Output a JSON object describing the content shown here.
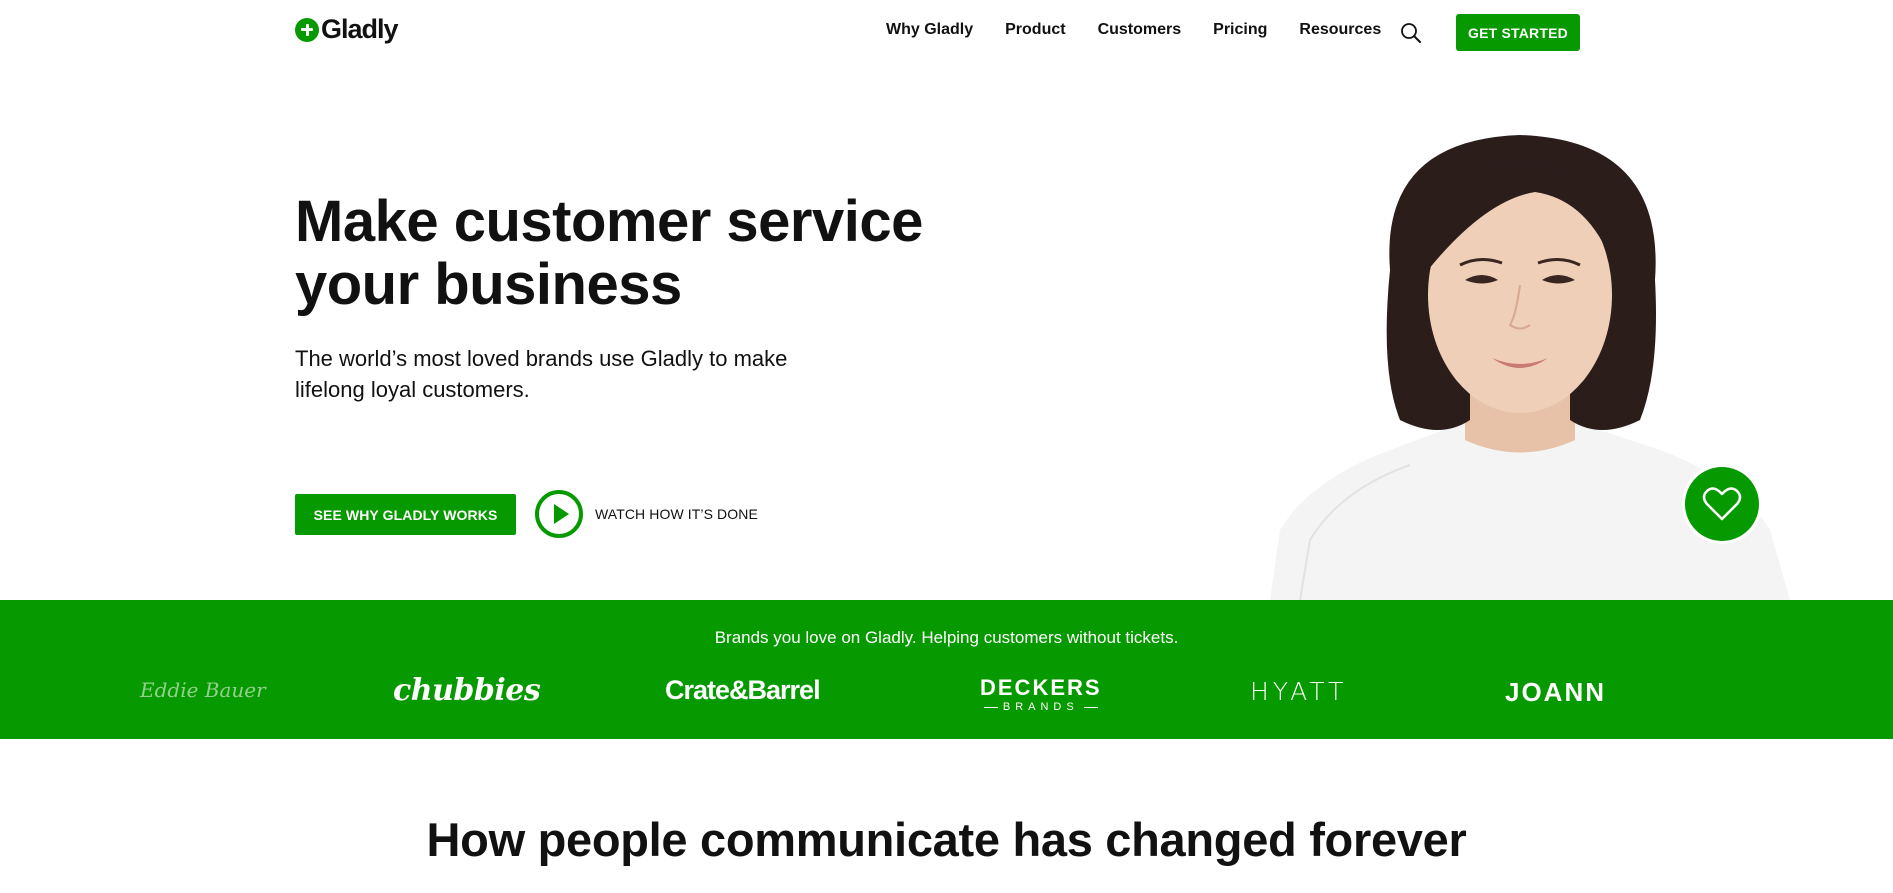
{
  "header": {
    "logo_text": "Gladly",
    "nav": [
      "Why Gladly",
      "Product",
      "Customers",
      "Pricing",
      "Resources"
    ],
    "search_icon": "search-icon",
    "cta": "GET STARTED"
  },
  "hero": {
    "title_line1": "Make customer service",
    "title_line2": "your business",
    "subtitle_line1": "The world’s most loved brands use Gladly to make",
    "subtitle_line2": "lifelong loyal customers.",
    "primary_button": "SEE WHY GLADLY WORKS",
    "watch_label": "WATCH HOW IT’S DONE",
    "heart_icon": "heart-icon"
  },
  "brands": {
    "caption": "Brands you love on Gladly. Helping customers without tickets.",
    "logos": {
      "eddie": "Eddie Bauer",
      "chubbies": "chubbies",
      "crate": "Crate&Barrel",
      "deckers_line1": "DECKERS",
      "deckers_line2": "BRANDS",
      "hyatt": "HYATT",
      "joann": "JOANN"
    }
  },
  "section": {
    "title": "How people communicate has changed forever"
  },
  "colors": {
    "brand_green": "#079a00",
    "text": "#111111",
    "background": "#ffffff"
  }
}
